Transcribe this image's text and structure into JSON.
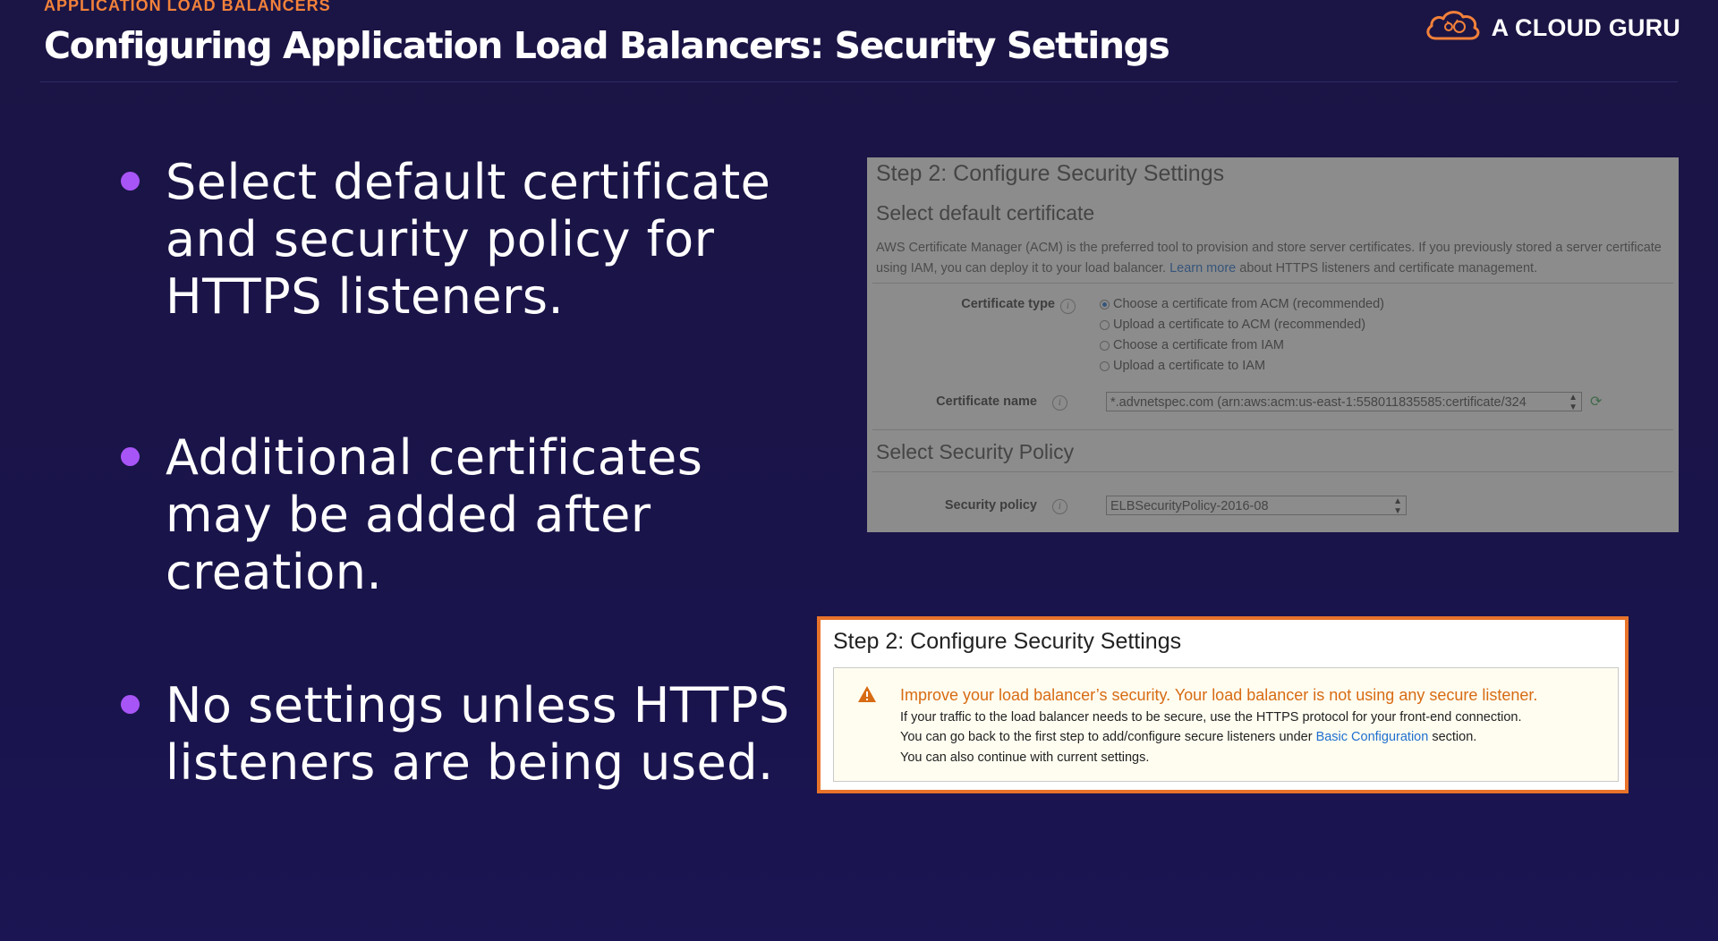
{
  "header": {
    "kicker": "APPLICATION LOAD BALANCERS",
    "title": "Configuring Application Load Balancers: Security Settings",
    "brand": "A CLOUD GURU"
  },
  "bullets": [
    {
      "text": "Select default certificate and security policy for HTTPS listeners."
    },
    {
      "text": "Additional certificates may be added after creation."
    },
    {
      "text": "No settings unless HTTPS listeners are being used."
    }
  ],
  "screenshot_settings": {
    "step_title": "Step 2: Configure Security Settings",
    "section_certificate": "Select default certificate",
    "description_before_link": "AWS Certificate Manager (ACM) is the preferred tool to provision and store server certificates. If you previously stored a server certificate using IAM, you can deploy it to your load balancer.",
    "description_link": "Learn more",
    "description_after_link": "about HTTPS listeners and certificate management.",
    "certificate_type_label": "Certificate type",
    "certificate_type_options": [
      {
        "label": "Choose a certificate from ACM (recommended)",
        "selected": true
      },
      {
        "label": "Upload a certificate to ACM (recommended)",
        "selected": false
      },
      {
        "label": "Choose a certificate from IAM",
        "selected": false
      },
      {
        "label": "Upload a certificate to IAM",
        "selected": false
      }
    ],
    "certificate_name_label": "Certificate name",
    "certificate_name_value": "*.advnetspec.com (arn:aws:acm:us-east-1:558011835585:certificate/324",
    "section_policy": "Select Security Policy",
    "security_policy_label": "Security policy",
    "security_policy_value": "ELBSecurityPolicy-2016-08"
  },
  "screenshot_warning": {
    "step_title": "Step 2: Configure Security Settings",
    "headline": "Improve your load balancer’s security. Your load balancer is not using any secure listener.",
    "line1": "If your traffic to the load balancer needs to be secure, use the HTTPS protocol for your front-end connection.",
    "line2_before_link": "You can go back to the first step to add/configure secure listeners under",
    "line2_link": "Basic Configuration",
    "line2_after_link": "section.",
    "line3": "You can also continue with current settings."
  },
  "colors": {
    "background": "#1a1547",
    "kicker": "#f2813a",
    "bullet_dot": "#a855f7",
    "warning_border": "#e8732a",
    "warning_text": "#d76b14",
    "link": "#1f6fd0"
  },
  "icons": [
    "cloud-logo-icon",
    "info-icon",
    "refresh-icon",
    "warning-icon",
    "select-arrows-icon"
  ]
}
